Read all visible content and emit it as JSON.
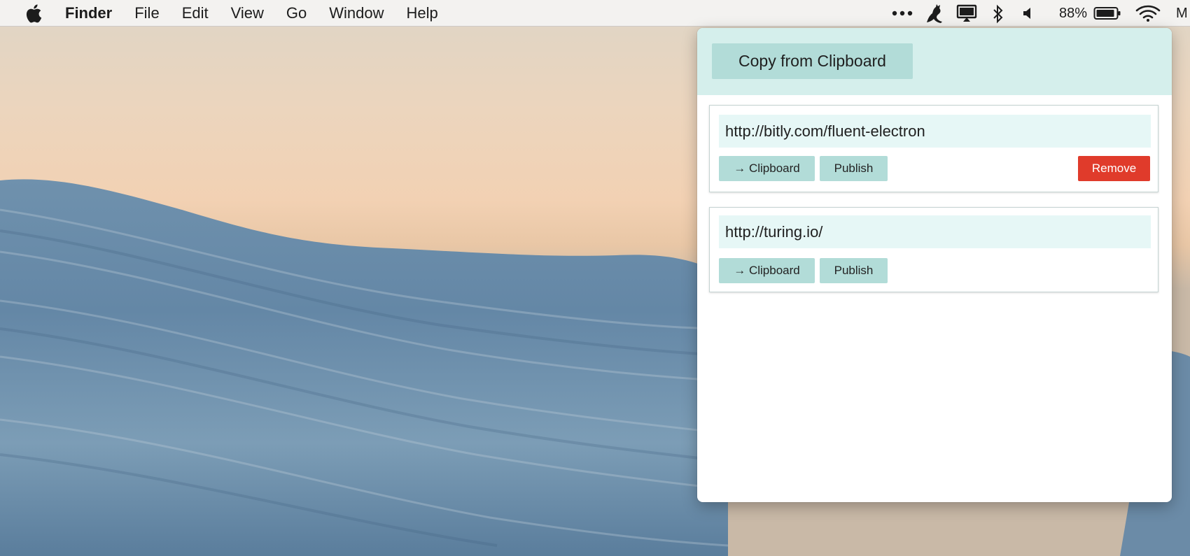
{
  "menubar": {
    "app_name": "Finder",
    "items": [
      "File",
      "Edit",
      "View",
      "Go",
      "Window",
      "Help"
    ],
    "battery_percent": "88%",
    "clipped_text": "M"
  },
  "status_icons": [
    "more-dots-icon",
    "cat-icon",
    "display-icon",
    "bluetooth-icon",
    "volume-icon",
    "battery-icon",
    "wifi-icon"
  ],
  "popover": {
    "copy_button_label": "Copy from Clipboard",
    "entries": [
      {
        "url": "http://bitly.com/fluent-electron",
        "clipboard_label": "→ Clipboard",
        "publish_label": "Publish",
        "remove_label": "Remove"
      },
      {
        "url": "http://turing.io/",
        "clipboard_label": "→ Clipboard",
        "publish_label": "Publish"
      }
    ]
  },
  "colors": {
    "header_bg": "#d5efec",
    "button_bg": "#b2dcd8",
    "field_bg": "#e6f7f6",
    "remove_bg": "#e03b2b"
  }
}
